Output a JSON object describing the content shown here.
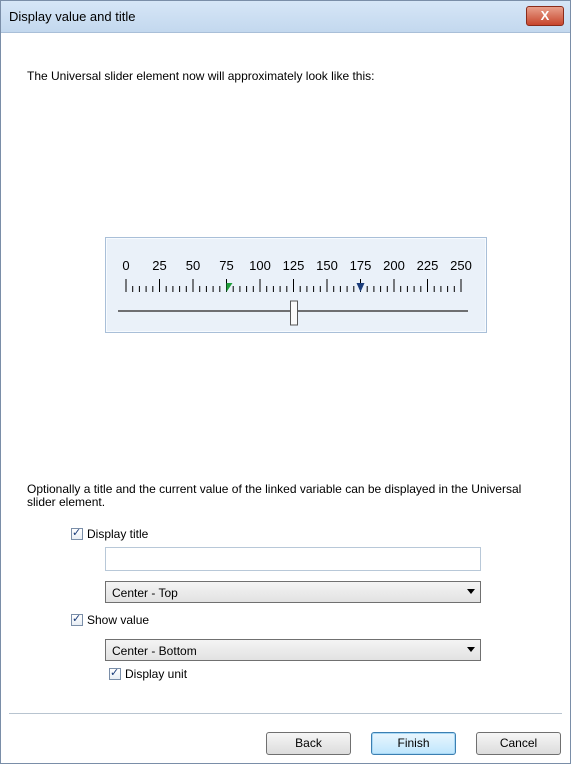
{
  "window": {
    "title": "Display value and title",
    "close_label": "X"
  },
  "intro_text": "The Universal slider element now will approximately look like this:",
  "preview": {
    "scale_labels": [
      "0",
      "25",
      "50",
      "75",
      "100",
      "125",
      "150",
      "175",
      "200",
      "225",
      "250"
    ],
    "scale_min": 0,
    "scale_max": 250,
    "marker_green_value": 75,
    "marker_blue_value": 175,
    "thumb_value": 125,
    "marker_green_color": "#1e9e3a",
    "marker_blue_color": "#1a3c7a"
  },
  "description": "Optionally a title and the current value of the linked variable can be displayed in the Universal slider element.",
  "display_title": {
    "label": "Display title",
    "checked": true,
    "value": "",
    "position": "Center - Top"
  },
  "show_value": {
    "label": "Show value",
    "checked": true,
    "position": "Center - Bottom"
  },
  "display_unit": {
    "label": "Display unit",
    "checked": true
  },
  "buttons": {
    "back": "Back",
    "finish": "Finish",
    "cancel": "Cancel"
  }
}
